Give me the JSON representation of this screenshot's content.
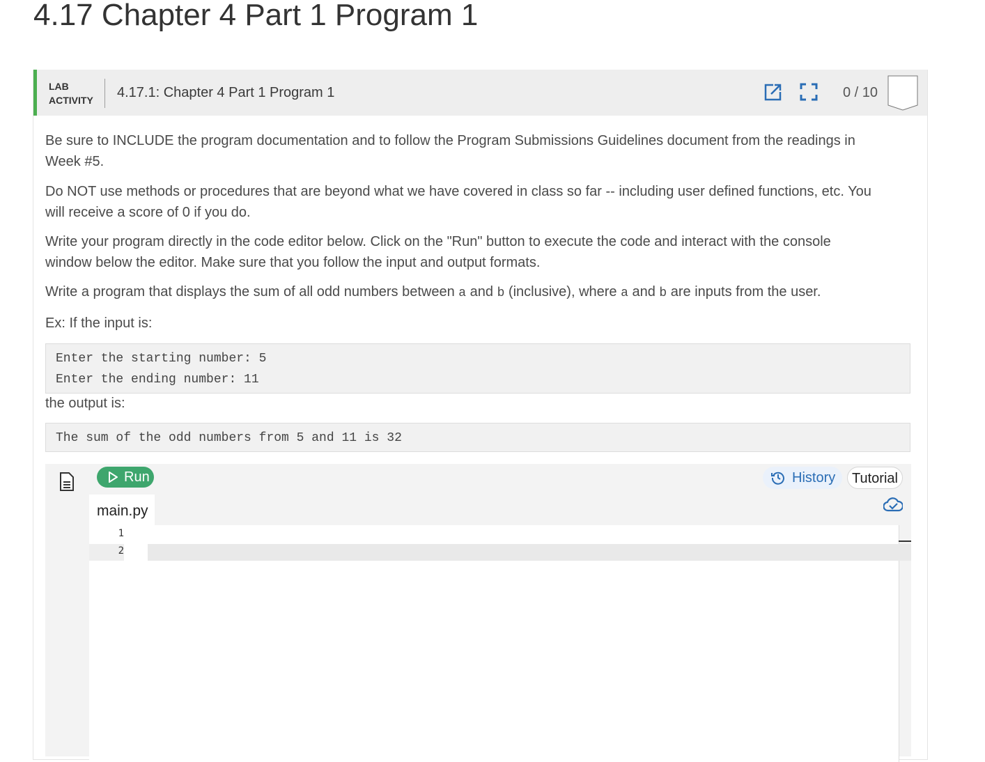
{
  "page": {
    "title": "4.17 Chapter 4 Part 1 Program 1"
  },
  "activity": {
    "label_line1": "LAB",
    "label_line2": "ACTIVITY",
    "title": "4.17.1: Chapter 4 Part 1 Program 1",
    "score": "0 / 10"
  },
  "instructions": {
    "p1_line1": "Be sure to INCLUDE the program documentation and to follow the Program Submissions Guidelines document from the readings in",
    "p1_line2": "Week #5.",
    "p2_line1": "Do NOT use methods or procedures that are beyond what we have covered in class so far -- including user defined functions, etc. You",
    "p2_line2": "will receive a score of 0 if you do.",
    "p3_line1": "Write your program directly in the code editor below.  Click on the \"Run\" button to execute the code and interact with the console",
    "p3_line2": "window below the editor. Make sure that you follow the input and output formats.",
    "p4_part1": "Write a program that displays the sum of all odd numbers between ",
    "p4_var_a": "a",
    "p4_part2": " and ",
    "p4_var_b": "b",
    "p4_part3": " (inclusive), where ",
    "p4_var_a2": "a",
    "p4_part4": " and ",
    "p4_var_b2": "b",
    "p4_part5": " are inputs from the user.",
    "example_intro": "Ex: If the input is:",
    "example_input_line1": "Enter the starting number: 5",
    "example_input_line2": "Enter the ending number: 11",
    "output_intro": "the output is:",
    "example_output": "The sum of the odd numbers from 5 and 11 is 32"
  },
  "editor": {
    "run_label": "Run",
    "history_label": "History",
    "tutorial_label": "Tutorial",
    "file_name": "main.py",
    "line_numbers": [
      "1",
      "2"
    ]
  },
  "icons": {
    "popout": "popout-icon",
    "fullscreen": "fullscreen-icon",
    "file": "file-icon",
    "history": "history-icon",
    "cloud": "cloud-check-icon"
  },
  "colors": {
    "accent_green": "#4caf50",
    "run_green": "#3ea66d",
    "link_blue": "#2a6db5"
  }
}
